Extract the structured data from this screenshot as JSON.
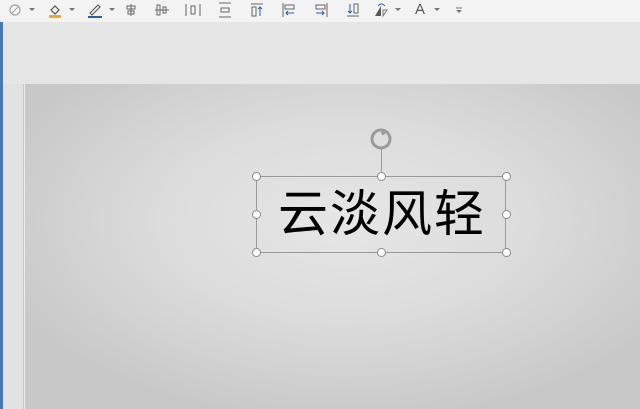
{
  "toolbar": {
    "tools": [
      {
        "name": "shape-fill-icon"
      },
      {
        "name": "paint-bucket-icon",
        "accent": "#f5a623"
      },
      {
        "name": "pen-outline-icon",
        "accent": "#2b5fb4"
      },
      {
        "name": "align-center-vertical-icon"
      },
      {
        "name": "align-middle-icon"
      },
      {
        "name": "distribute-horizontal-icon"
      },
      {
        "name": "distribute-vertical-icon"
      },
      {
        "name": "bring-forward-icon"
      },
      {
        "name": "align-left-icon"
      },
      {
        "name": "align-right-icon"
      },
      {
        "name": "send-backward-icon"
      },
      {
        "name": "rotate-flip-icon"
      },
      {
        "name": "text-style-icon"
      },
      {
        "name": "more-options-icon"
      }
    ],
    "text_style_label": "A"
  },
  "canvas": {
    "selected_text": "云淡风轻"
  },
  "colors": {
    "frame_accent": "#4a78b5",
    "handle_border": "#8a8a8a"
  }
}
